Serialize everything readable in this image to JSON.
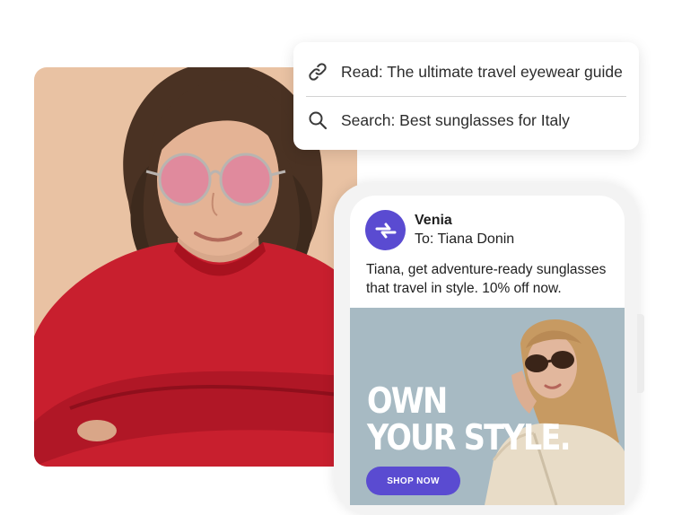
{
  "activity": {
    "items": [
      {
        "icon": "link-icon",
        "text": "Read: The ultimate travel eyewear guide"
      },
      {
        "icon": "search-icon",
        "text": "Search: Best sunglasses for Italy"
      }
    ]
  },
  "email": {
    "sender_name": "Venia",
    "recipient": "To: Tiana Donin",
    "body": "Tiana, get adventure-ready sunglasses that travel in style. 10% off now.",
    "promo": {
      "headline_line1": "OWN",
      "headline_line2": "YOUR STYLE.",
      "button_label": "SHOP NOW"
    }
  },
  "colors": {
    "brand": "#5a4bd1",
    "photo_bg": "#e9c2a3",
    "sweater": "#c81f2e",
    "banner_bg": "#a7bac3"
  }
}
